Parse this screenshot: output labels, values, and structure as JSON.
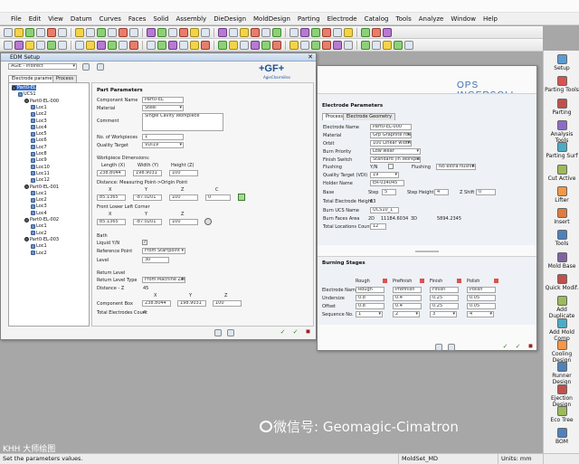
{
  "menu": [
    "File",
    "Edit",
    "View",
    "Datum",
    "Curves",
    "Faces",
    "Solid",
    "Assembly",
    "DieDesign",
    "MoldDesign",
    "Parting",
    "Electrode",
    "Catalog",
    "Tools",
    "Analyze",
    "Window",
    "Help"
  ],
  "right_panel": [
    {
      "label": "Setup",
      "color": "#5b9bd5"
    },
    {
      "label": "Parting Tools",
      "color": "#d9534f"
    },
    {
      "label": "Parting",
      "color": "#c0504d"
    },
    {
      "label": "Analysis Tools",
      "color": "#8e6ac8"
    },
    {
      "label": "Parting Surf",
      "color": "#4bacc6"
    },
    {
      "label": "Cut Active",
      "color": "#9bbb59"
    },
    {
      "label": "Lifter",
      "color": "#f79646"
    },
    {
      "label": "Insert",
      "color": "#e07c3e"
    },
    {
      "label": "Tools",
      "color": "#4f81bd"
    },
    {
      "label": "Mold Base",
      "color": "#8064a2"
    },
    {
      "label": "Quick Modif.",
      "color": "#c0504d"
    },
    {
      "label": "Add Duplicate",
      "color": "#9bbb59"
    },
    {
      "label": "Add Mold Comp",
      "color": "#4bacc6"
    },
    {
      "label": "Cooling Design",
      "color": "#f79646"
    },
    {
      "label": "Runner Design",
      "color": "#4f81bd"
    },
    {
      "label": "Ejection Design",
      "color": "#c0504d"
    },
    {
      "label": "Eco Tree",
      "color": "#9bbb59"
    },
    {
      "label": "BOM",
      "color": "#4f81bd"
    }
  ],
  "status": {
    "hint": "Set the parameters values.",
    "assembly": "MoldSet_MD",
    "units": "Units: mm"
  },
  "watermark": {
    "text": "微信号: Geomagic-Cimatron",
    "corner": "KHH 大师绘图"
  },
  "left_dialog": {
    "title": "EDM Setup",
    "machine_select": "AGIE - Indirect",
    "tabs": [
      "Electrode parameters",
      "Process"
    ],
    "logo": "+GF+",
    "logo_sub": "AgieCharmilles",
    "tree": [
      {
        "label": "Part0-EL",
        "level": 0,
        "pin": true
      },
      {
        "label": "UCS1",
        "level": 1,
        "pin": false
      },
      {
        "label": "Part0-EL-000",
        "level": 2,
        "pin": true
      },
      {
        "label": "Loc1",
        "level": 3,
        "pin": false
      },
      {
        "label": "Loc2",
        "level": 3,
        "pin": false
      },
      {
        "label": "Loc3",
        "level": 3,
        "pin": false
      },
      {
        "label": "Loc4",
        "level": 3,
        "pin": false
      },
      {
        "label": "Loc5",
        "level": 3,
        "pin": false
      },
      {
        "label": "Loc6",
        "level": 3,
        "pin": false
      },
      {
        "label": "Loc7",
        "level": 3,
        "pin": false
      },
      {
        "label": "Loc8",
        "level": 3,
        "pin": false
      },
      {
        "label": "Loc9",
        "level": 3,
        "pin": false
      },
      {
        "label": "Loc10",
        "level": 3,
        "pin": false
      },
      {
        "label": "Loc11",
        "level": 3,
        "pin": false
      },
      {
        "label": "Loc12",
        "level": 3,
        "pin": false
      },
      {
        "label": "Part0-EL-001",
        "level": 2,
        "pin": true
      },
      {
        "label": "Loc1",
        "level": 3,
        "pin": false
      },
      {
        "label": "Loc2",
        "level": 3,
        "pin": false
      },
      {
        "label": "Loc3",
        "level": 3,
        "pin": false
      },
      {
        "label": "Loc4",
        "level": 3,
        "pin": false
      },
      {
        "label": "Part0-EL-002",
        "level": 2,
        "pin": true
      },
      {
        "label": "Loc1",
        "level": 3,
        "pin": false
      },
      {
        "label": "Loc2",
        "level": 3,
        "pin": false
      },
      {
        "label": "Part0-EL-003",
        "level": 2,
        "pin": true
      },
      {
        "label": "Loc1",
        "level": 3,
        "pin": false
      },
      {
        "label": "Loc2",
        "level": 3,
        "pin": false
      }
    ],
    "part_params": {
      "header": "Part Parameters",
      "component_name_label": "Component Name",
      "component_name": "Part0-EL",
      "material_label": "Material",
      "material": "Steel",
      "comment_label": "Comment",
      "comment": "Single Cavity Workpiece",
      "workpieces_label": "No. of Workpieces",
      "workpieces": "1",
      "quality_label": "Quality Target",
      "quality": "VDI19",
      "dims_label": "Workpiece Dimensions:",
      "dim_heads": [
        "Length (X)",
        "Width (Y)",
        "Height (Z)"
      ],
      "dims": [
        "238.8044",
        "198.9031",
        "100"
      ],
      "distance_label": "Distance: Measuring Point->Origin Point",
      "xyzc": [
        "X",
        "Y",
        "Z",
        "C"
      ],
      "distance": [
        "85.1365",
        "-87.0201",
        "100",
        "0"
      ],
      "flc_label": "Front Lower Left Corner",
      "flc_heads": [
        "X",
        "Y",
        "Z"
      ],
      "flc": [
        "85.1365",
        "-87.0201",
        "100"
      ],
      "bath_label": "Bath",
      "liquid_label": "Liquid Y/N",
      "ref_label": "Reference Point",
      "ref": "From Startpoint",
      "level_label": "Level",
      "level": "30",
      "return_label": "Return Level",
      "return_type_label": "Return Level Type",
      "return_type": "From Machine Zero",
      "distz_label": "Distance - Z",
      "distz": "45",
      "box_label": "Component Box",
      "box": [
        "238.8044",
        "198.9031",
        "100"
      ],
      "total_label": "Total Electrodes Count",
      "total": "4"
    }
  },
  "right_dialog": {
    "logo": "OPS INGERSOLL",
    "header": "Electrode Parameters",
    "tabs": [
      "Process",
      "Electrode Geometry"
    ],
    "rows": [
      {
        "label": "Electrode Name",
        "value": "Part0-EL-000"
      },
      {
        "label": "Material",
        "value": "Grp Graphite rough"
      },
      {
        "label": "Orbit",
        "value": "100 Linear width"
      },
      {
        "label": "Burn Priority",
        "value": "Low wear"
      },
      {
        "label": "Finish Switch",
        "value": "Standard (in Workpiece)"
      }
    ],
    "flushing_label": "Flushing",
    "flushing": "Y/N",
    "flushing2_label": "Flushing",
    "flushing2": "No extra flushing",
    "quality_label": "Quality Target (VDI)",
    "quality": "19",
    "holder_label": "Holder Name",
    "holder": "ER-034045",
    "base_label": "Base",
    "step_label": "Step",
    "step": "5",
    "stepheight_label": "Step Height",
    "stepheight": "4",
    "zshift_label": "Z Shift",
    "zshift": "0",
    "total_height_label": "Total Electrode Height",
    "total_height": "63",
    "ucs_label": "Burn UCS Name",
    "ucs": "UCS10_1",
    "faces_label": "Burn Faces Area",
    "faces_2d_label": "2D",
    "faces_2d": "11184.6034",
    "faces_3d_label": "3D",
    "faces_3d": "5894.2345",
    "loc_label": "Total Locations Count",
    "loc": "12",
    "burning_header": "Burning Stages",
    "stage_heads": [
      "Rough",
      "Prefinish",
      "Finish",
      "Polish"
    ],
    "stage_rows": [
      {
        "label": "Electrode Name",
        "values": [
          "Rough",
          "Prefinish",
          "Finish",
          "Polish"
        ]
      },
      {
        "label": "Undersize",
        "values": [
          "0.8",
          "0.4",
          "0.25",
          "0.05"
        ]
      },
      {
        "label": "Offset",
        "values": [
          "0.8",
          "0.4",
          "0.25",
          "0.05"
        ]
      },
      {
        "label": "Sequence No.",
        "values": [
          "1",
          "2",
          "3",
          "4"
        ]
      }
    ]
  }
}
